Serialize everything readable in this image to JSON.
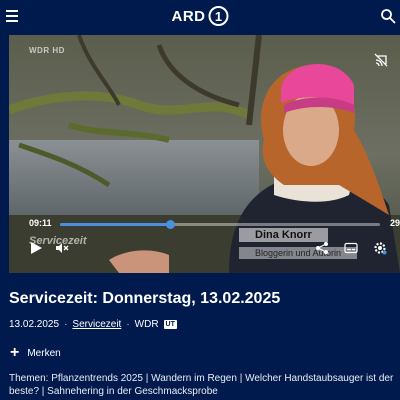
{
  "header": {
    "logo_text": "ARD",
    "logo_mark": "1",
    "menu_icon": "hamburger-menu-icon",
    "search_icon": "search-icon"
  },
  "player": {
    "channel_bug": "WDR HD",
    "watermark": "Servicezeit",
    "lower_third": {
      "name": "Dina Knorr",
      "role": "Bloggerin und Autorin"
    },
    "time_current": "09:11",
    "time_end": "29",
    "progress_fraction": 0.345,
    "accent_color": "#4a90e2",
    "icons": [
      "cast-off-icon",
      "play-icon",
      "mute-icon",
      "share-icon",
      "subtitles-icon",
      "settings-icon"
    ]
  },
  "info": {
    "title": "Servicezeit: Donnerstag, 13.02.2025",
    "date": "13.02.2025",
    "dot1": "·",
    "show_link": "Servicezeit",
    "dot2": "·",
    "channel": "WDR",
    "ut_badge": "UT",
    "merken_label": "Merken",
    "themes": "Themen: Pflanzentrends 2025 | Wandern im Regen | Welcher Handstaubsauger ist der beste? | Sahnehering in der Geschmacksprobe"
  },
  "colors": {
    "background": "#001a4d",
    "text": "#ffffff"
  }
}
